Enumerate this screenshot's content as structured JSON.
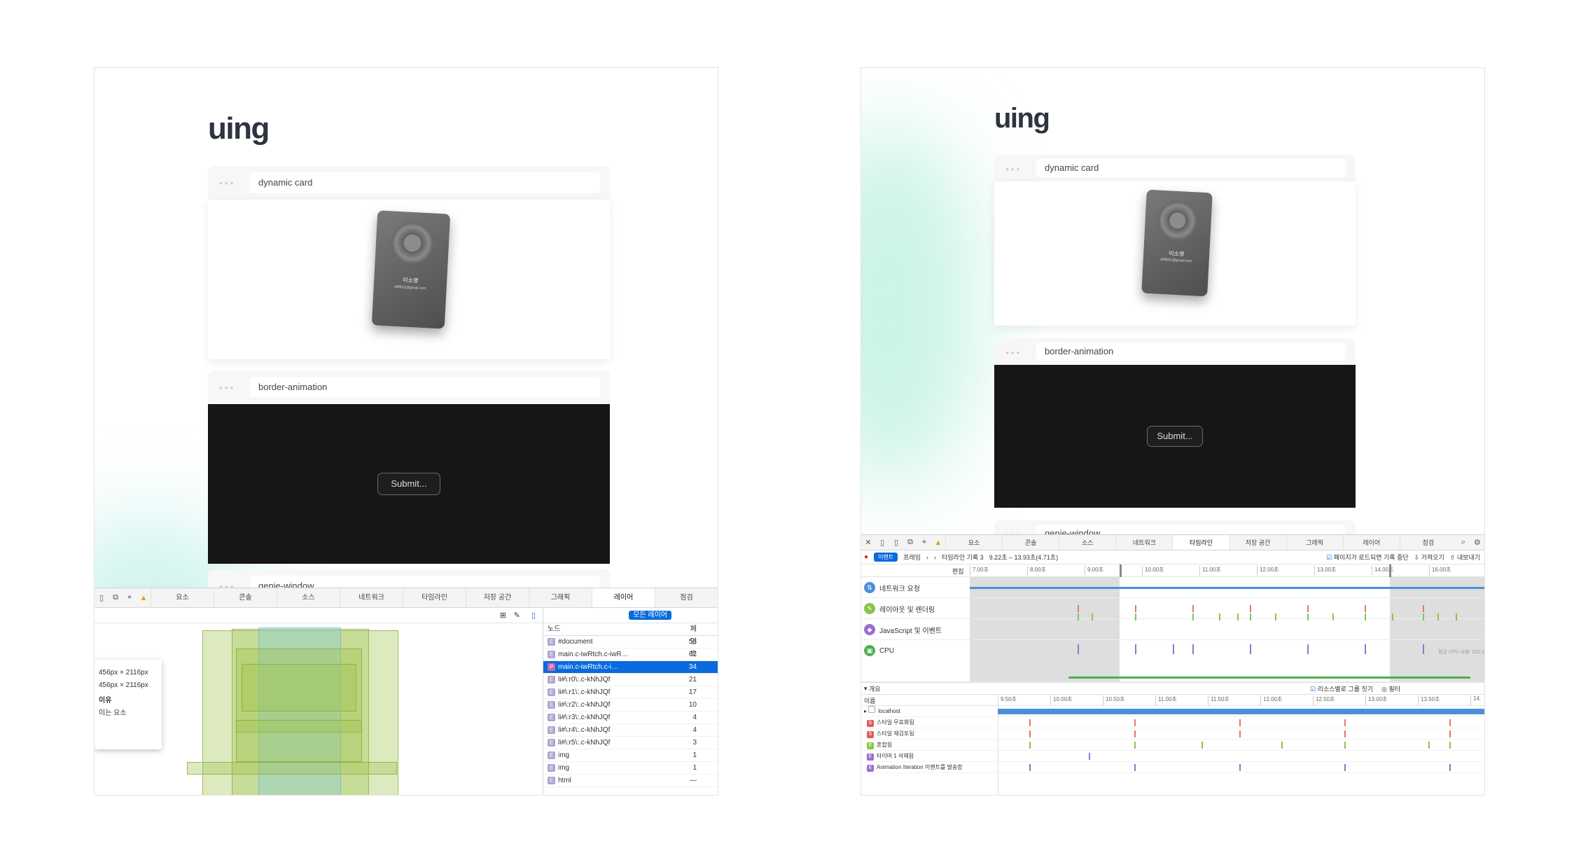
{
  "brand": "uing",
  "windows": {
    "card_title": "dynamic card",
    "border_title": "border-animation",
    "genie_title": "genie-window",
    "submit_label": "Submit...",
    "card_name": "이소영",
    "card_email": "offlife01@gmail.com"
  },
  "devtools": {
    "tabs": [
      "요소",
      "콘솔",
      "소스",
      "네트워크",
      "타임라인",
      "저장 공간",
      "그래픽",
      "레이어",
      "점검"
    ],
    "layers": {
      "all_layers_button": "모든 레이어",
      "tooltip": [
        "456px × 2116px",
        "456px × 2116px",
        "이유",
        "이는 요소"
      ],
      "col_node": "노드",
      "col_paint": "페인트",
      "rows": [
        {
          "badge": "E",
          "name": "#document",
          "value": "58"
        },
        {
          "badge": "E",
          "name": "main.c-iwRtch.c-iwR…",
          "value": "62"
        },
        {
          "badge": "P",
          "name": "main.c-iwRtch.c-i…",
          "value": "34",
          "selected": true
        },
        {
          "badge": "E",
          "name": "li#\\:r0\\:.c-kNhJQf",
          "value": "21"
        },
        {
          "badge": "E",
          "name": "li#\\:r1\\:.c-kNhJQf",
          "value": "17"
        },
        {
          "badge": "E",
          "name": "li#\\:r2\\:.c-kNhJQf",
          "value": "10"
        },
        {
          "badge": "E",
          "name": "li#\\:r3\\:.c-kNhJQf",
          "value": "4"
        },
        {
          "badge": "E",
          "name": "li#\\:r4\\:.c-kNhJQf",
          "value": "4"
        },
        {
          "badge": "E",
          "name": "li#\\:r5\\:.c-kNhJQf",
          "value": "3"
        },
        {
          "badge": "E",
          "name": "img",
          "value": "1"
        },
        {
          "badge": "E",
          "name": "img",
          "value": "1"
        },
        {
          "badge": "E",
          "name": "html",
          "value": "—"
        }
      ]
    },
    "timeline": {
      "mode_events": "이벤트",
      "mode_frames": "프레임",
      "recording": "타임라인 기록 3",
      "range": "9.22초 – 13.93초(4.71초)",
      "stop_on_load": "페이지가 로드되면 기록 중단",
      "import": "가져오기",
      "export": "내보내기",
      "edit": "편집",
      "ticks": [
        "7.00초",
        "8.00초",
        "9.00초",
        "10.00초",
        "11.00초",
        "12.00초",
        "13.00초",
        "14.00초",
        "16.00초"
      ],
      "categories": [
        "네트워크 요청",
        "레이아웃 및 렌더링",
        "JavaScript 및 이벤트",
        "CPU"
      ],
      "cpu_note": "평균 CPU 사용: 202.3",
      "overview": "개요",
      "group_by_resource": "리소스별로 그룹 짓기",
      "filter": "필터",
      "col_name": "이름",
      "ticks2": [
        "9.50초",
        "10.00초",
        "10.50초",
        "11.00초",
        "11.50초",
        "12.00초",
        "12.50초",
        "13.00초",
        "13.50초",
        "14."
      ],
      "records": [
        {
          "sq": "",
          "name": "localhost"
        },
        {
          "sq": "S",
          "name": "스타일 무효화됨"
        },
        {
          "sq": "S",
          "name": "스타일 재검토됨"
        },
        {
          "sq": "E",
          "name": "혼합됨"
        },
        {
          "sq": "E",
          "name": "타이머 1 삭제됨"
        },
        {
          "sq": "E",
          "name": "Animation Iteration 이벤트를 발송함"
        }
      ]
    }
  }
}
